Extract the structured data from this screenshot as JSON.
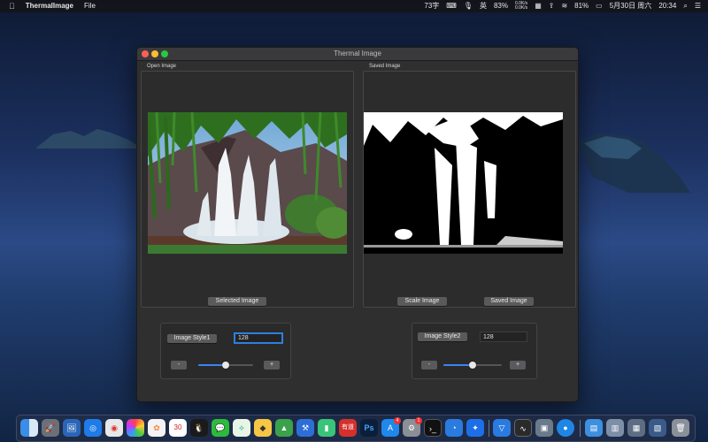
{
  "menubar": {
    "apple_icon": "",
    "app_name": "ThermalImage",
    "menu_file": "File",
    "ime_count": "73字",
    "input_source": "英",
    "cpu": "83%",
    "net_up": "0.0K/s",
    "net_down": "0.0K/s",
    "battery": "81%",
    "date": "5月30日 周六",
    "time": "20:34"
  },
  "window": {
    "title": "Thermal Image",
    "open_label": "Open Image",
    "saved_label": "Saved Image",
    "selected_button": "Selected Image",
    "scale_button": "Scale Image",
    "saved_button": "Saved Image"
  },
  "style1": {
    "button": "Image Style1",
    "value": "128",
    "minus": "-",
    "plus": "+",
    "level": 0.5
  },
  "style2": {
    "button": "Image Style2",
    "value": "128",
    "minus": "-",
    "plus": "+",
    "level": 0.5
  },
  "dock": {
    "calendar_day": "30",
    "ps_label": "Ps",
    "youdao_label": "有道",
    "appstore_badge": "4",
    "prefs_badge": "1"
  }
}
